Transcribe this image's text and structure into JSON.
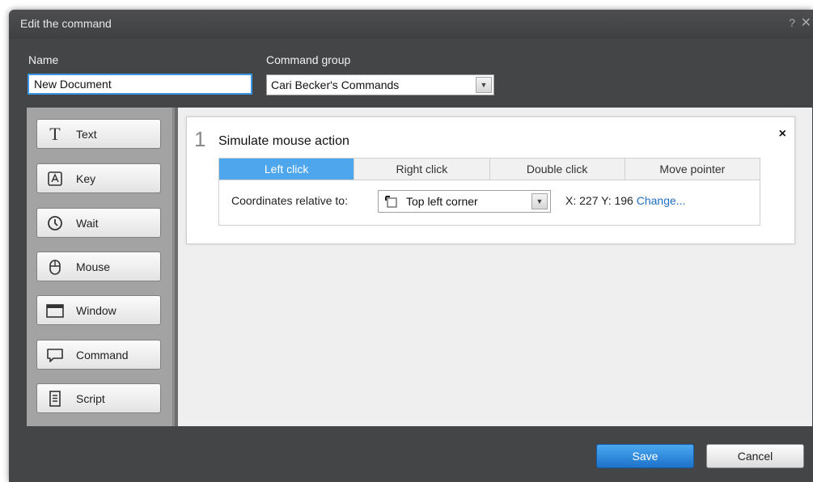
{
  "dialog": {
    "title": "Edit the command",
    "help_label": "?",
    "close_label": "✕"
  },
  "form": {
    "name_label": "Name",
    "name_value": "New Document",
    "group_label": "Command group",
    "group_value": "Cari Becker's Commands"
  },
  "toolbox": {
    "items": [
      {
        "label": "Text",
        "icon": "text-icon"
      },
      {
        "label": "Key",
        "icon": "key-icon"
      },
      {
        "label": "Wait",
        "icon": "clock-icon"
      },
      {
        "label": "Mouse",
        "icon": "mouse-icon"
      },
      {
        "label": "Window",
        "icon": "window-icon"
      },
      {
        "label": "Command",
        "icon": "speech-bubble-icon"
      },
      {
        "label": "Script",
        "icon": "script-icon"
      }
    ]
  },
  "step": {
    "number": "1",
    "title": "Simulate mouse action",
    "close_label": "×",
    "tabs": [
      {
        "label": "Left click",
        "active": true
      },
      {
        "label": "Right click",
        "active": false
      },
      {
        "label": "Double click",
        "active": false
      },
      {
        "label": "Move pointer",
        "active": false
      }
    ],
    "coords_label": "Coordinates relative to:",
    "relative_value": "Top left corner",
    "x_label": "X: 227",
    "y_label": "Y: 196",
    "change_link": "Change..."
  },
  "footer": {
    "save_label": "Save",
    "cancel_label": "Cancel"
  },
  "colors": {
    "dialog_bg": "#444546",
    "accent": "#4ea6ec",
    "save_button": "#2a84d8",
    "link": "#1f6fc5"
  }
}
